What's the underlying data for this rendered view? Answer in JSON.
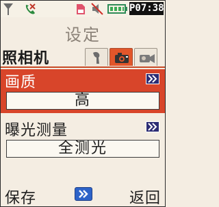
{
  "status_bar": {
    "icons": [
      "signal-antenna-icon",
      "missed-call-icon",
      "memory-card-icon",
      "mute-icon",
      "battery-icon"
    ],
    "time": "P07:38"
  },
  "header": {
    "title": "设定"
  },
  "category": {
    "label": "照相机",
    "tabs": [
      {
        "icon": "wrench-icon",
        "active": false
      },
      {
        "icon": "camera-icon",
        "active": true
      },
      {
        "icon": "video-camera-icon",
        "active": false
      }
    ]
  },
  "settings": [
    {
      "label": "画质",
      "value": "高",
      "selected": true
    },
    {
      "label": "曝光测量",
      "value": "全测光",
      "selected": false
    }
  ],
  "softkeys": {
    "left": "保存",
    "center_icon": "forward-arrow-icon",
    "right": "返回"
  },
  "colors": {
    "accent": "#d8452a",
    "button": "#2d2d74",
    "center_key": "#2d63c8"
  }
}
